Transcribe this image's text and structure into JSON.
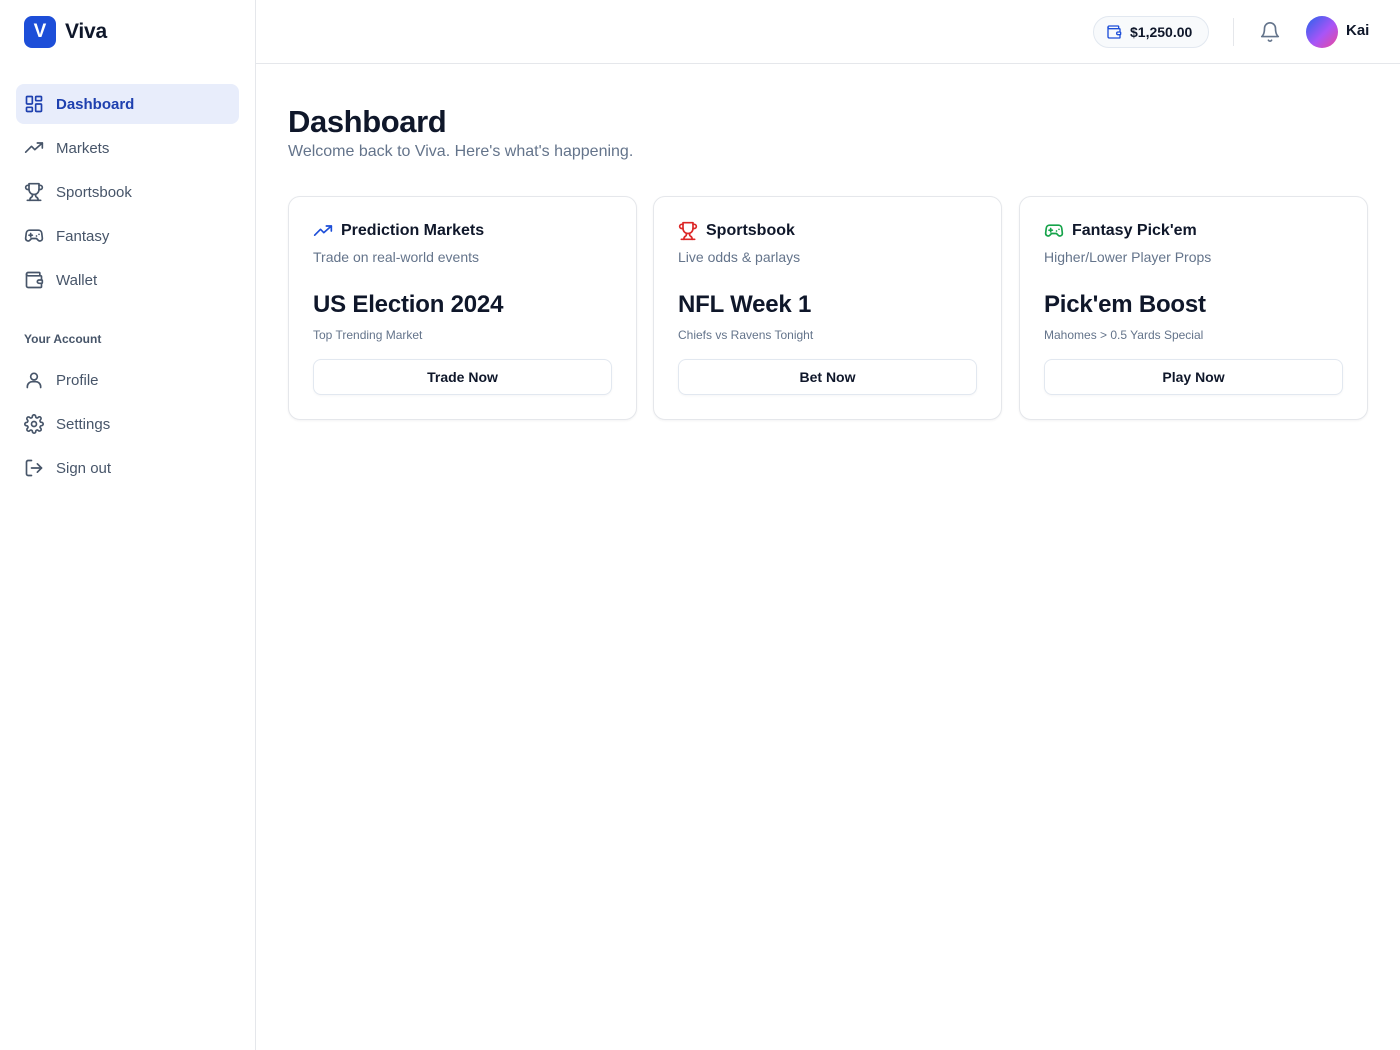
{
  "brand": {
    "mark": "V",
    "name": "Viva",
    "color": "#1d4ed8"
  },
  "sidebar": {
    "items": [
      {
        "label": "Dashboard",
        "icon": "dashboard-icon",
        "active": true
      },
      {
        "label": "Markets",
        "icon": "trending-up-icon"
      },
      {
        "label": "Sportsbook",
        "icon": "trophy-icon"
      },
      {
        "label": "Fantasy",
        "icon": "gamepad-icon"
      },
      {
        "label": "Wallet",
        "icon": "wallet-icon"
      }
    ],
    "section_label": "Your Account",
    "account_items": [
      {
        "label": "Profile",
        "icon": "user-icon"
      },
      {
        "label": "Settings",
        "icon": "gear-icon"
      },
      {
        "label": "Sign out",
        "icon": "sign-out-icon"
      }
    ]
  },
  "header": {
    "balance": "$1,250.00",
    "user_name": "Kai"
  },
  "main": {
    "title": "Dashboard",
    "subtitle": "Welcome back to Viva. Here's what's happening."
  },
  "cards": [
    {
      "title": "Prediction Markets",
      "icon": "trending-up-icon",
      "icon_color": "#1d4ed8",
      "description": "Trade on real-world events",
      "feature": "US Election 2024",
      "feature_sub": "Top Trending Market",
      "button": "Trade Now"
    },
    {
      "title": "Sportsbook",
      "icon": "trophy-icon",
      "icon_color": "#dc2626",
      "description": "Live odds & parlays",
      "feature": "NFL Week 1",
      "feature_sub": "Chiefs vs Ravens Tonight",
      "button": "Bet Now"
    },
    {
      "title": "Fantasy Pick'em",
      "icon": "gamepad-icon",
      "icon_color": "#16a34a",
      "description": "Higher/Lower Player Props",
      "feature": "Pick'em Boost",
      "feature_sub": "Mahomes > 0.5 Yards Special",
      "button": "Play Now"
    }
  ]
}
